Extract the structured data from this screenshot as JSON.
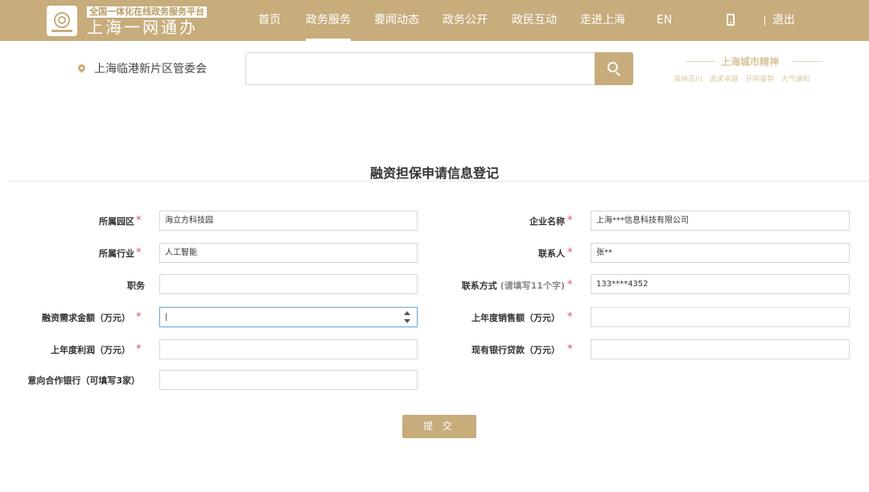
{
  "brand": {
    "subtitle": "全国一体化在线政务服务平台",
    "title": "上海一网通办"
  },
  "nav": {
    "items": [
      "首页",
      "政务服务",
      "要闻动态",
      "政务公开",
      "政民互动",
      "走进上海",
      "EN"
    ],
    "active": "政务服务",
    "logout": "退出"
  },
  "location": "上海临港新片区管委会",
  "search": {
    "value": ""
  },
  "slogan": {
    "title": "上海城市精神",
    "sub": "海纳百川 · 追求卓越 · 开明睿智 · 大气谦和"
  },
  "form": {
    "title": "融资担保申请信息登记",
    "fields": {
      "park": {
        "label": "所属园区",
        "value": "海立方科技园"
      },
      "company": {
        "label": "企业名称",
        "value": "上海***信息科技有限公司"
      },
      "industry": {
        "label": "所属行业",
        "value": "人工智能"
      },
      "contact": {
        "label": "联系人",
        "value": "张**"
      },
      "position": {
        "label": "职务",
        "value": ""
      },
      "phone": {
        "label": "联系方式",
        "hint": "(请填写11个字)",
        "value": "133****4352"
      },
      "financing_amount": {
        "label": "融资需求金额（万元）",
        "value": "|"
      },
      "last_year_sales": {
        "label": "上年度销售额（万元）",
        "value": ""
      },
      "last_year_profit": {
        "label": "上年度利润（万元）",
        "value": ""
      },
      "bank_loans": {
        "label": "现有银行贷款（万元）",
        "value": ""
      },
      "banks": {
        "label": "意向合作银行（可填写3家）",
        "value": ""
      }
    },
    "submit": "提 交"
  },
  "colors": {
    "accent": "#c7ac7c",
    "required": "#e24c4c"
  }
}
